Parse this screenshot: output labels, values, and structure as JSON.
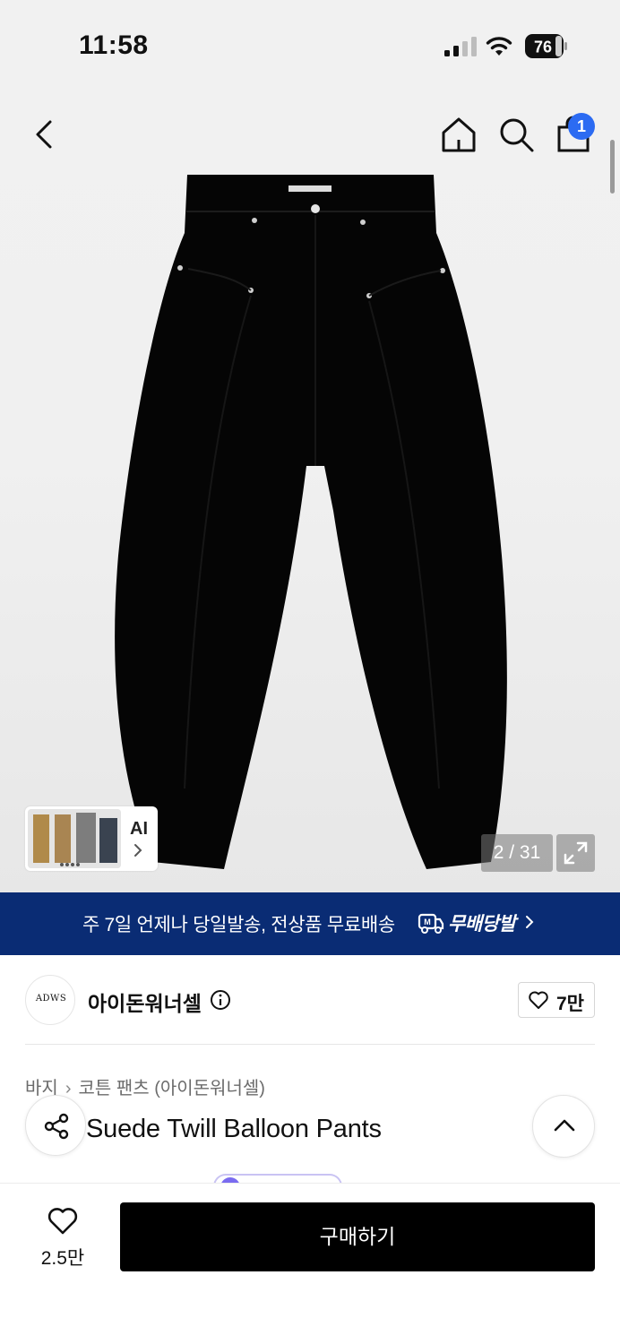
{
  "status_bar": {
    "time": "11:58",
    "battery": "76"
  },
  "nav": {
    "back_icon": "chevron-left-icon",
    "home_icon": "home-icon",
    "search_icon": "search-icon",
    "bag_icon": "shopping-bag-icon",
    "bag_count": "1"
  },
  "gallery": {
    "ai_label": "AI",
    "current_page": "2",
    "total_pages": "31",
    "counter": "2 / 31",
    "expand_icon": "expand-icon"
  },
  "banner": {
    "text": "주 7일 언제나 당일발송, 전상품 무료배송",
    "brand": "무배당발",
    "icon": "delivery-truck-icon",
    "bg_color": "#0a2c74"
  },
  "brand": {
    "logo_text": "ADWS",
    "name": "아이돈워너셀",
    "likes": "7만"
  },
  "breadcrumb": {
    "category": "바지",
    "subcategory": "코튼 팬츠 (아이돈워너셀)"
  },
  "product": {
    "title": "Suede Twill Balloon Pants"
  },
  "bottom_bar": {
    "like_count": "2.5만",
    "buy_label": "구매하기"
  },
  "colors": {
    "accent": "#2c6bf2",
    "banner": "#0a2c74",
    "buy_button": "#000000"
  }
}
